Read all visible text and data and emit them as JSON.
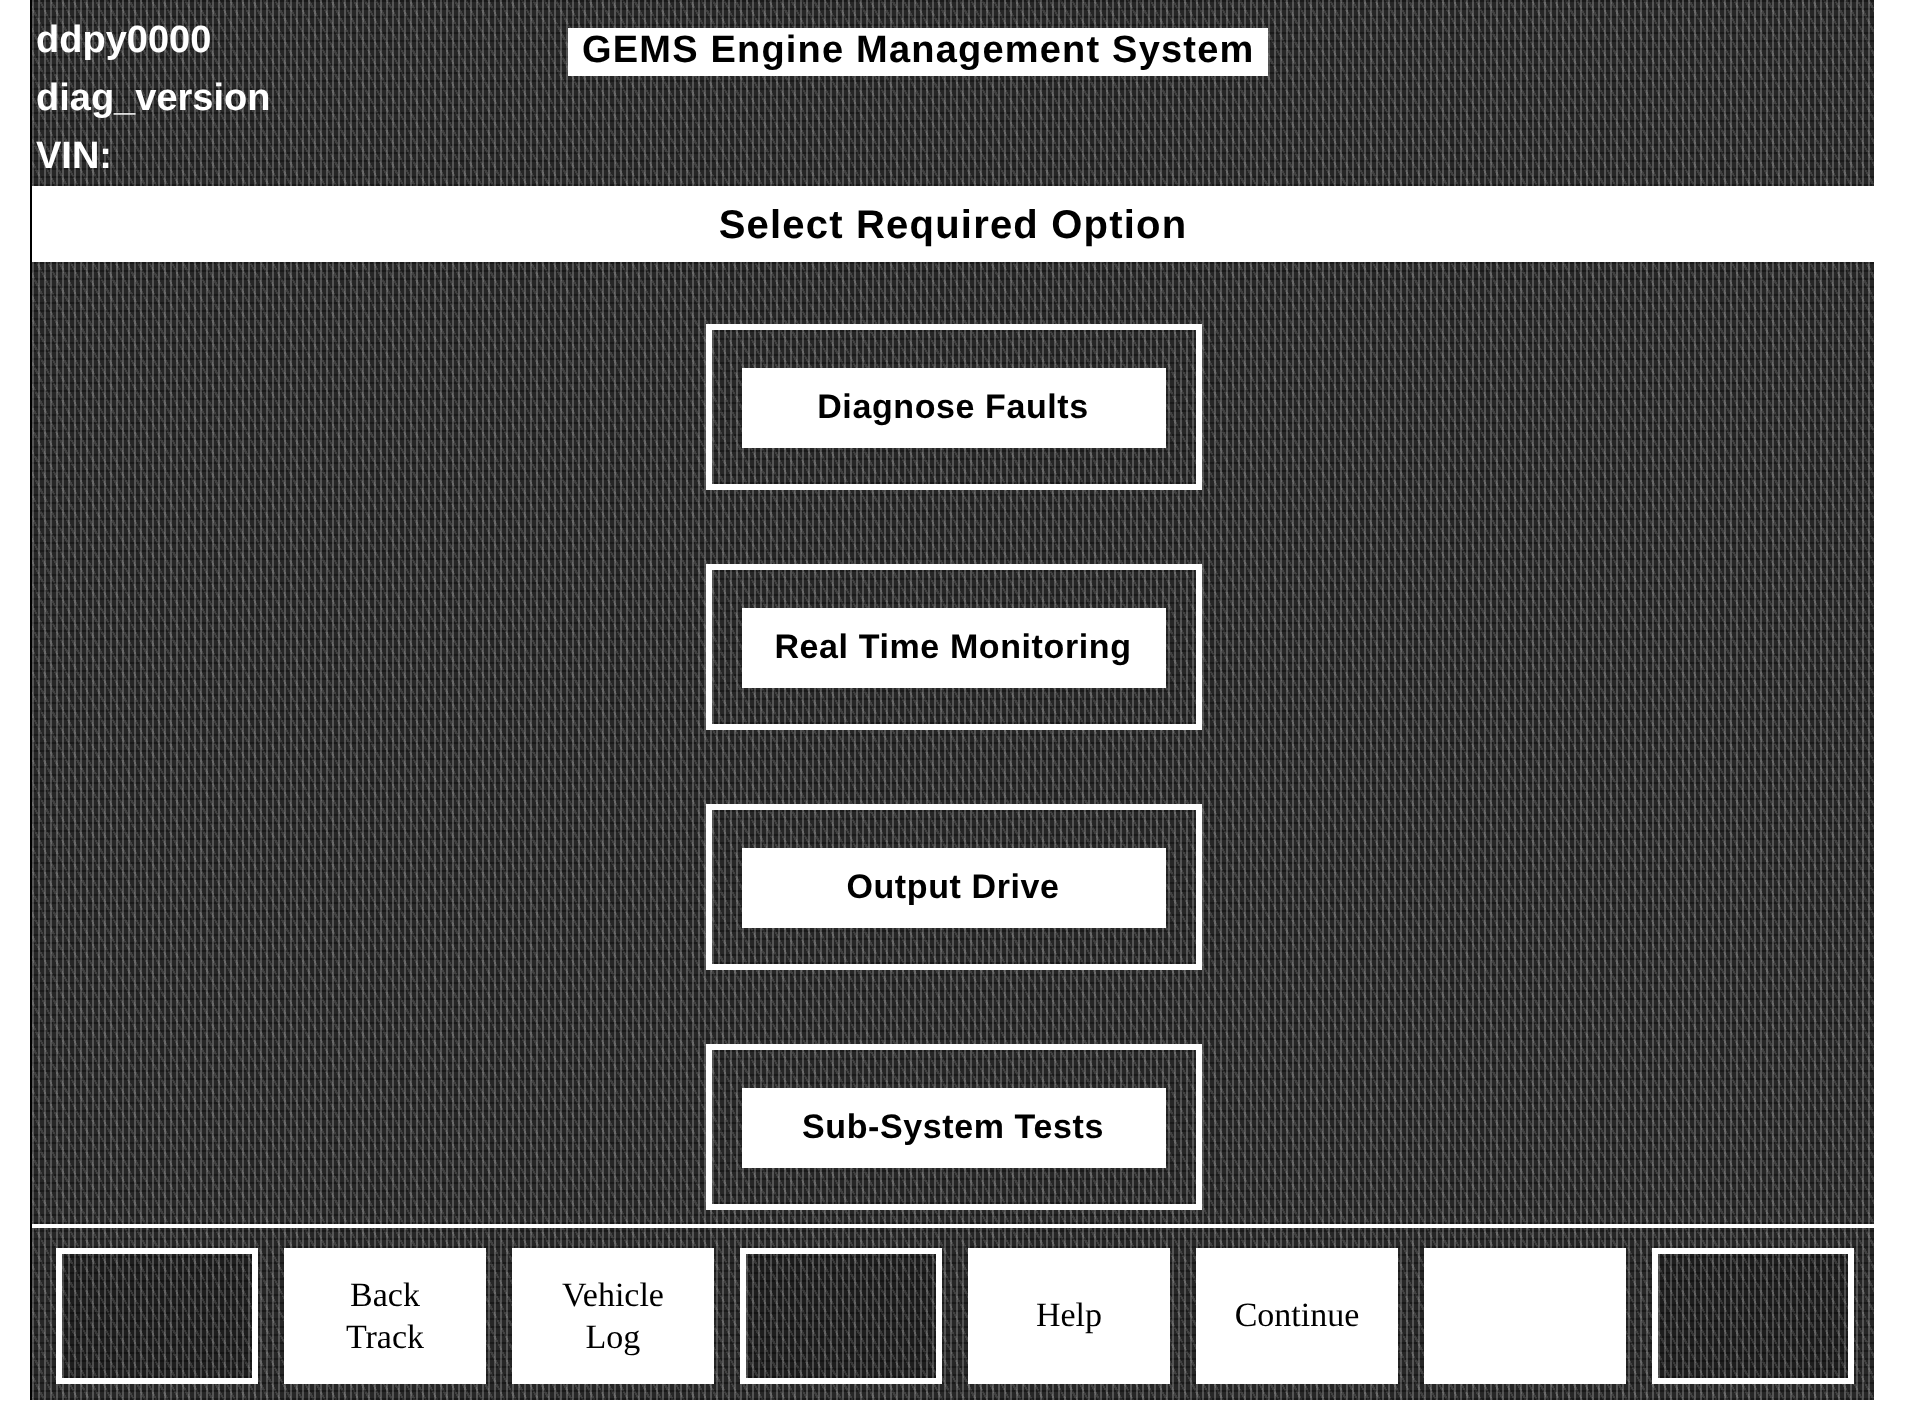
{
  "header": {
    "lines": [
      "ddpy0000",
      "diag_version",
      "VIN:"
    ],
    "title": "GEMS Engine Management System"
  },
  "prompt": "Select Required Option",
  "options": [
    {
      "label": "Diagnose Faults"
    },
    {
      "label": "Real Time Monitoring"
    },
    {
      "label": "Output Drive"
    },
    {
      "label": "Sub-System Tests"
    }
  ],
  "function_keys": [
    {
      "enabled": false
    },
    {
      "label": "Back Track",
      "enabled": true
    },
    {
      "label": "Vehicle Log",
      "enabled": true
    },
    {
      "enabled": false
    },
    {
      "label": "Help",
      "enabled": true
    },
    {
      "label": "Continue",
      "enabled": true
    },
    {
      "enabled": true
    },
    {
      "enabled": false
    }
  ]
}
